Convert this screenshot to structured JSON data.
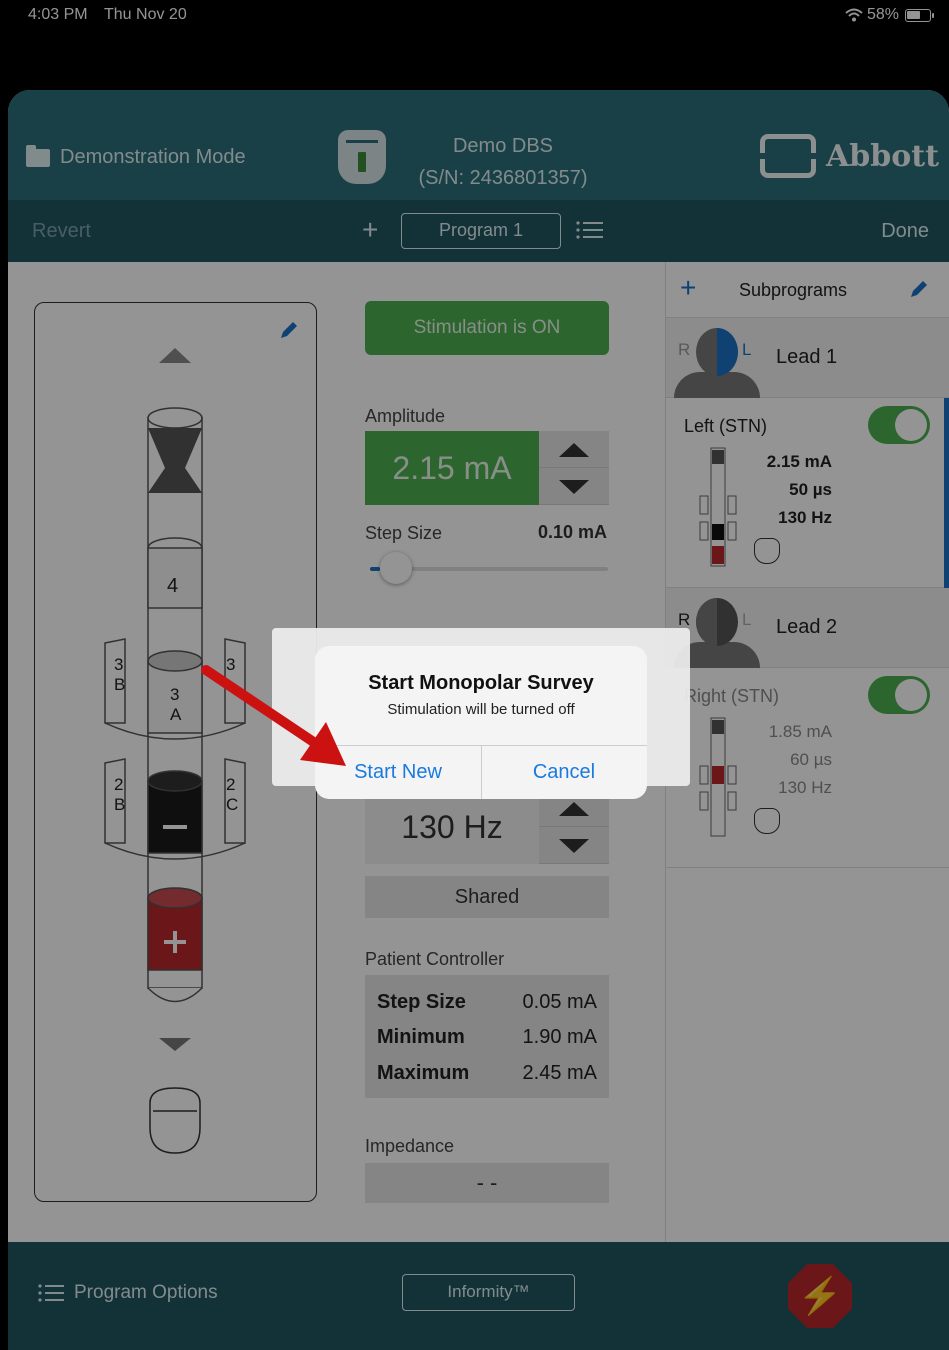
{
  "status_bar": {
    "time": "4:03 PM",
    "date": "Thu Nov 20",
    "battery": "58%"
  },
  "header": {
    "mode": "Demonstration Mode",
    "device_name": "Demo DBS",
    "serial": "(S/N: 2436801357)",
    "brand": "Abbott"
  },
  "toolbar": {
    "revert": "Revert",
    "plus": "+",
    "program": "Program 1",
    "done": "Done"
  },
  "stimulation": {
    "label": "Stimulation is ON"
  },
  "amplitude": {
    "label": "Amplitude",
    "value": "2.15 mA"
  },
  "step_size": {
    "label": "Step Size",
    "value": "0.10 mA",
    "slider_fraction": 0.04
  },
  "frequency": {
    "value": "130 Hz"
  },
  "shared": "Shared",
  "patient_controller": {
    "label": "Patient Controller",
    "rows": [
      {
        "key": "Step Size",
        "value": "0.05 mA"
      },
      {
        "key": "Minimum",
        "value": "1.90 mA"
      },
      {
        "key": "Maximum",
        "value": "2.45 mA"
      }
    ]
  },
  "impedance": {
    "label": "Impedance",
    "value": "- -"
  },
  "lead_contacts": {
    "top": "4",
    "mid3": [
      "3",
      "B",
      "3",
      "A",
      "3"
    ],
    "mid2": [
      "2",
      "B",
      "2",
      "C"
    ]
  },
  "subprograms": {
    "title": "Subprograms",
    "leads": [
      {
        "r": "R",
        "l": "L",
        "name": "Lead 1"
      },
      {
        "r": "R",
        "l": "L",
        "name": "Lead 2"
      }
    ],
    "cards": [
      {
        "title": "Left (STN)",
        "amp": "2.15 mA",
        "pw": "50 µs",
        "freq": "130 Hz"
      },
      {
        "title": "Right (STN)",
        "amp": "1.85 mA",
        "pw": "60 µs",
        "freq": "130 Hz"
      }
    ]
  },
  "dialog": {
    "title": "Start Monopolar Survey",
    "message": "Stimulation will be turned off",
    "primary": "Start New",
    "secondary": "Cancel"
  },
  "footer": {
    "options": "Program Options",
    "informity": "Informity™"
  },
  "colors": {
    "header": "#2b6e7a",
    "toolbar": "#1f5661",
    "green": "#4caf50",
    "blue": "#1a73c6",
    "red": "#b8262b",
    "arrow": "#cc1111"
  }
}
